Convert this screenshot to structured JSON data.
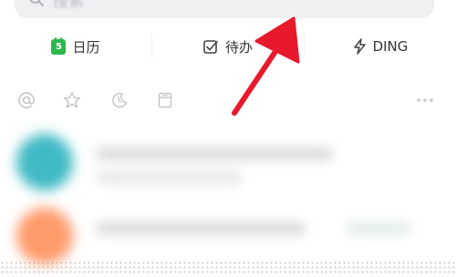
{
  "search": {
    "placeholder": "搜索"
  },
  "quick_actions": [
    {
      "label": "日历",
      "icon": "calendar-icon",
      "badge": "5"
    },
    {
      "label": "待办",
      "icon": "checkbox-icon"
    },
    {
      "label": "DING",
      "icon": "lightning-icon"
    }
  ],
  "filter_icons": [
    "at-icon",
    "star-icon",
    "moon-icon",
    "archive-icon",
    "more-icon"
  ],
  "colors": {
    "calendar_green": "#2db84d",
    "arrow_red": "#e8192c",
    "avatar_teal": "#3fb9c4",
    "avatar_orange": "#ff9a6b"
  }
}
